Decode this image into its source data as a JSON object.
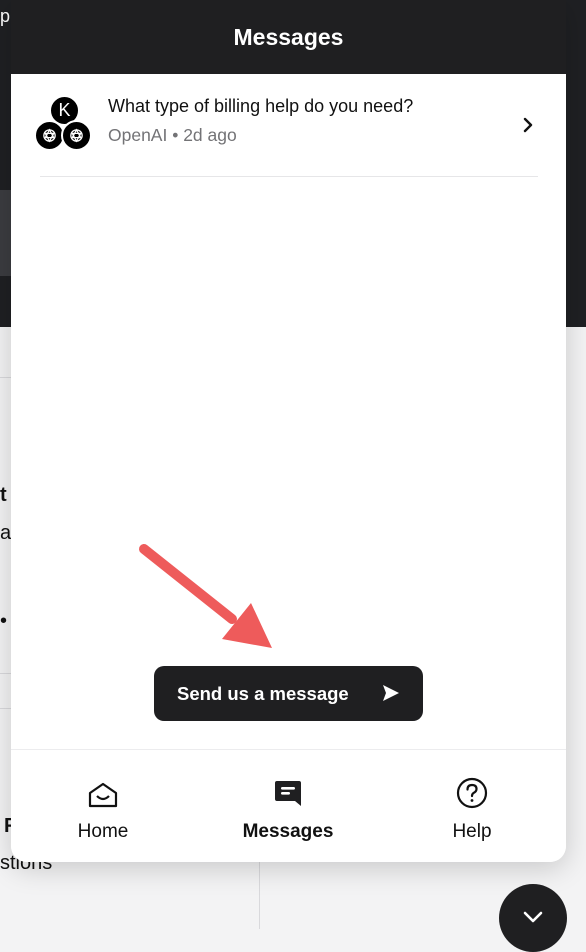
{
  "background": {
    "frag_top": "p",
    "frag_a": "t",
    "frag_b": "a",
    "frag_c": "•",
    "frag_d": "F",
    "frag_e": "stions"
  },
  "widget": {
    "title": "Messages",
    "conversation": {
      "avatar_letter": "K",
      "title": "What type of billing help do you need?",
      "meta": "OpenAI • 2d ago"
    },
    "send_button_label": "Send us a message",
    "tabs": [
      {
        "label": "Home",
        "icon": "home-icon"
      },
      {
        "label": "Messages",
        "icon": "messages-icon",
        "active": true
      },
      {
        "label": "Help",
        "icon": "help-icon"
      }
    ]
  },
  "colors": {
    "dark": "#1f1f21",
    "accent_arrow": "#ee5b5b",
    "meta_text": "#737376"
  }
}
